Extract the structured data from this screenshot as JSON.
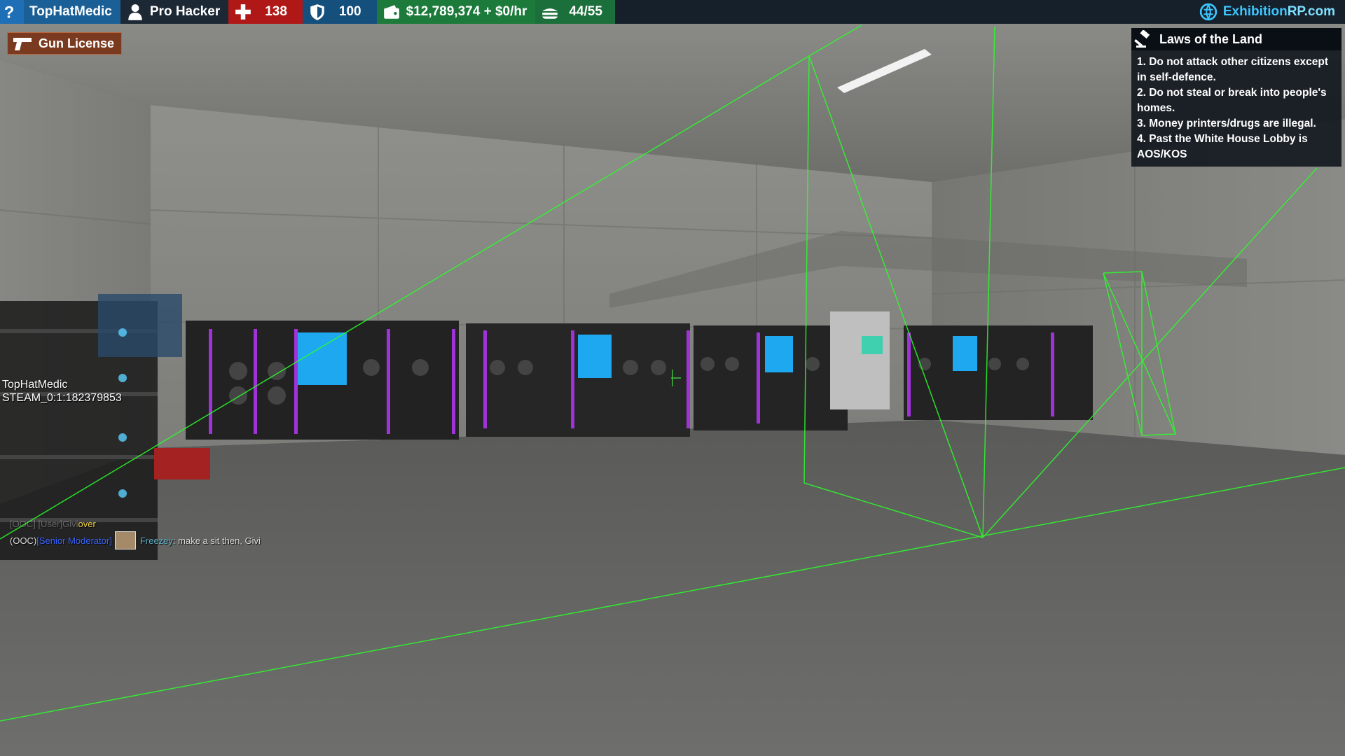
{
  "hud": {
    "help_icon": "question-mark-icon",
    "player_name": "TopHatMedic",
    "job_icon": "user-icon",
    "job": "Pro Hacker",
    "health_icon": "plus-icon",
    "health": "138",
    "armor_icon": "shield-icon",
    "armor": "100",
    "money_icon": "wallet-icon",
    "money": "$12,789,374 + $0/hr",
    "food_icon": "food-icon",
    "food": "44/55",
    "site_icon": "server-logo-icon",
    "site_name_a": "Exhibition",
    "site_name_b": "RP.com"
  },
  "license": {
    "icon": "pistol-icon",
    "label": "Gun License"
  },
  "laws": {
    "icon": "gavel-icon",
    "title": "Laws of the Land",
    "items": [
      "1. Do not attack other citizens except in self-defence.",
      "2. Do not steal or break into people's homes.",
      "3. Money printers/drugs are illegal.",
      "4. Past the White House Lobby is AOS/KOS"
    ]
  },
  "nametag": {
    "name": "TopHatMedic",
    "steam": "STEAM_0:1:182379853"
  },
  "chat": {
    "line1": {
      "prefix": "[OOC] [User] ",
      "name": "Givi",
      "text": " over"
    },
    "line2": {
      "channel": "(OOC) ",
      "rank": "[Senior Moderator]",
      "name": "Freezey",
      "text": ": make a sit then, Givi"
    }
  },
  "colors": {
    "hud_bg": "#15202b",
    "health": "#b01818",
    "armor": "#154f7c",
    "money": "#1c7a3a",
    "site_accent": "#3cc6ff",
    "wireframe": "#2aff2a"
  }
}
